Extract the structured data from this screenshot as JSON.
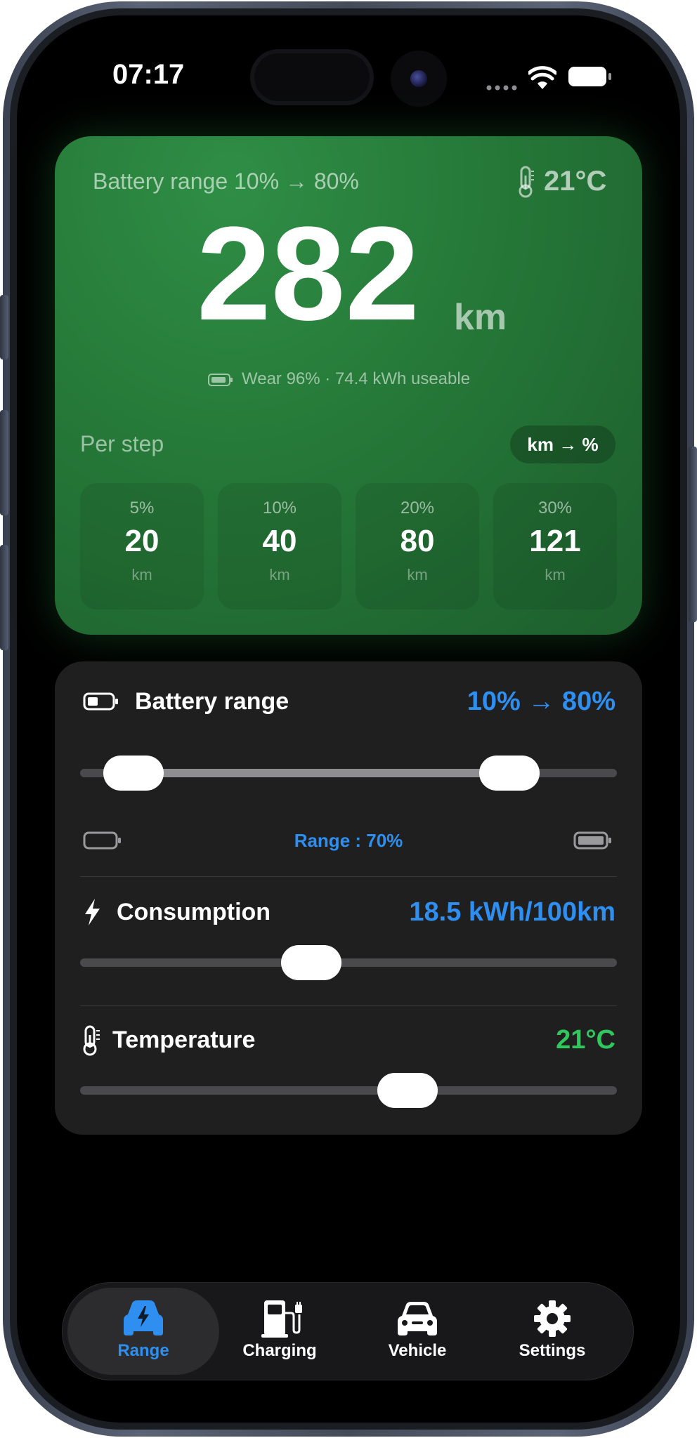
{
  "status_bar": {
    "time": "07:17"
  },
  "hero": {
    "title": "Battery range 10% → 80%",
    "temperature": "21°C",
    "range_value": "282",
    "range_unit": "km",
    "wear_text": "Wear 96% · 74.4 kWh useable",
    "per_step_label": "Per step",
    "toggle_label": "km → %",
    "steps": [
      {
        "percent": "5%",
        "value": "20",
        "unit": "km"
      },
      {
        "percent": "10%",
        "value": "40",
        "unit": "km"
      },
      {
        "percent": "20%",
        "value": "80",
        "unit": "km"
      },
      {
        "percent": "30%",
        "value": "121",
        "unit": "km"
      }
    ]
  },
  "controls": {
    "battery": {
      "label": "Battery range",
      "value": "10% → 80%",
      "range_text": "Range : 70%",
      "low_percent": 10,
      "high_percent": 80
    },
    "consumption": {
      "label": "Consumption",
      "value": "18.5 kWh/100km",
      "position": 0.43
    },
    "temperature": {
      "label": "Temperature",
      "value": "21°C",
      "position": 0.61
    }
  },
  "tabs": [
    {
      "label": "Range",
      "icon": "car-bolt-icon",
      "active": true
    },
    {
      "label": "Charging",
      "icon": "fuel-pump-icon",
      "active": false
    },
    {
      "label": "Vehicle",
      "icon": "car-icon",
      "active": false
    },
    {
      "label": "Settings",
      "icon": "gear-icon",
      "active": false
    }
  ],
  "colors": {
    "accent_blue": "#2f8ff0",
    "accent_green": "#30c75c",
    "hero_green": "#257838"
  }
}
